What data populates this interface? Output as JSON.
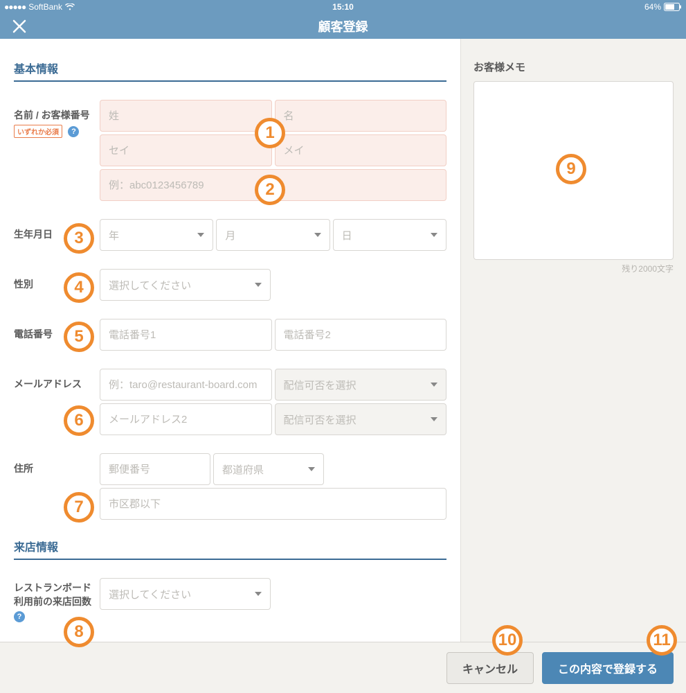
{
  "status": {
    "carrier": "SoftBank",
    "time": "15:10",
    "battery": "64%"
  },
  "title": "顧客登録",
  "sections": {
    "basic": "基本情報",
    "visit": "来店情報"
  },
  "labels": {
    "name": "名前 / お客様番号",
    "required_either": "いずれか必須",
    "birthdate": "生年月日",
    "gender": "性別",
    "phone": "電話番号",
    "email": "メールアドレス",
    "address": "住所",
    "prior_visits": "レストランボード利用前の来店回数"
  },
  "placeholders": {
    "sei_kanji": "姓",
    "mei_kanji": "名",
    "sei_kana": "セイ",
    "mei_kana": "メイ",
    "customer_no": "例：abc0123456789",
    "year": "年",
    "month": "月",
    "day": "日",
    "please_select": "選択してください",
    "phone1": "電話番号1",
    "phone2": "電話番号2",
    "email1": "例：taro@restaurant-board.com",
    "email2": "メールアドレス2",
    "delivery_pref": "配信可否を選択",
    "postal": "郵便番号",
    "prefecture": "都道府県",
    "city_below": "市区郡以下"
  },
  "memo": {
    "title": "お客様メモ",
    "counter": "残り2000文字"
  },
  "buttons": {
    "cancel": "キャンセル",
    "submit": "この内容で登録する"
  },
  "annotations": [
    "1",
    "2",
    "3",
    "4",
    "5",
    "6",
    "7",
    "8",
    "9",
    "10",
    "11"
  ]
}
